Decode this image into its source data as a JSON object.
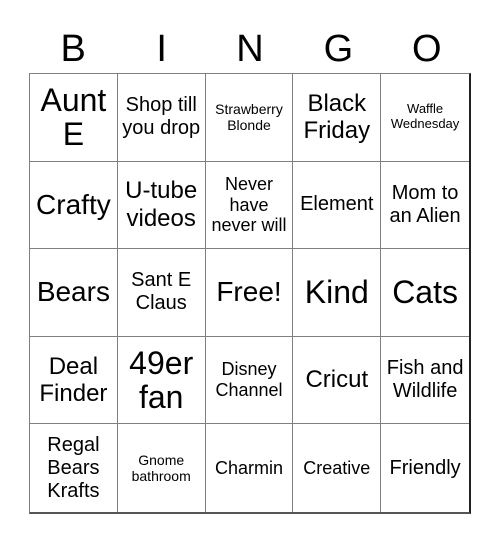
{
  "title_letters": [
    "B",
    "I",
    "N",
    "G",
    "O"
  ],
  "grid": [
    [
      "Aunt E",
      "Shop till you drop",
      "Strawberry Blonde",
      "Black Friday",
      "Waffle Wednesday"
    ],
    [
      "Crafty",
      "U-tube videos",
      "Never have never will",
      "Element",
      "Mom to an Alien"
    ],
    [
      "Bears",
      "Sant E Claus",
      "Free!",
      "Kind",
      "Cats"
    ],
    [
      "Deal Finder",
      "49er fan",
      "Disney Channel",
      "Cricut",
      "Fish and Wildlife"
    ],
    [
      "Regal Bears Krafts",
      "Gnome bathroom",
      "Charmin",
      "Creative",
      "Friendly"
    ]
  ],
  "free_space": "Free!"
}
